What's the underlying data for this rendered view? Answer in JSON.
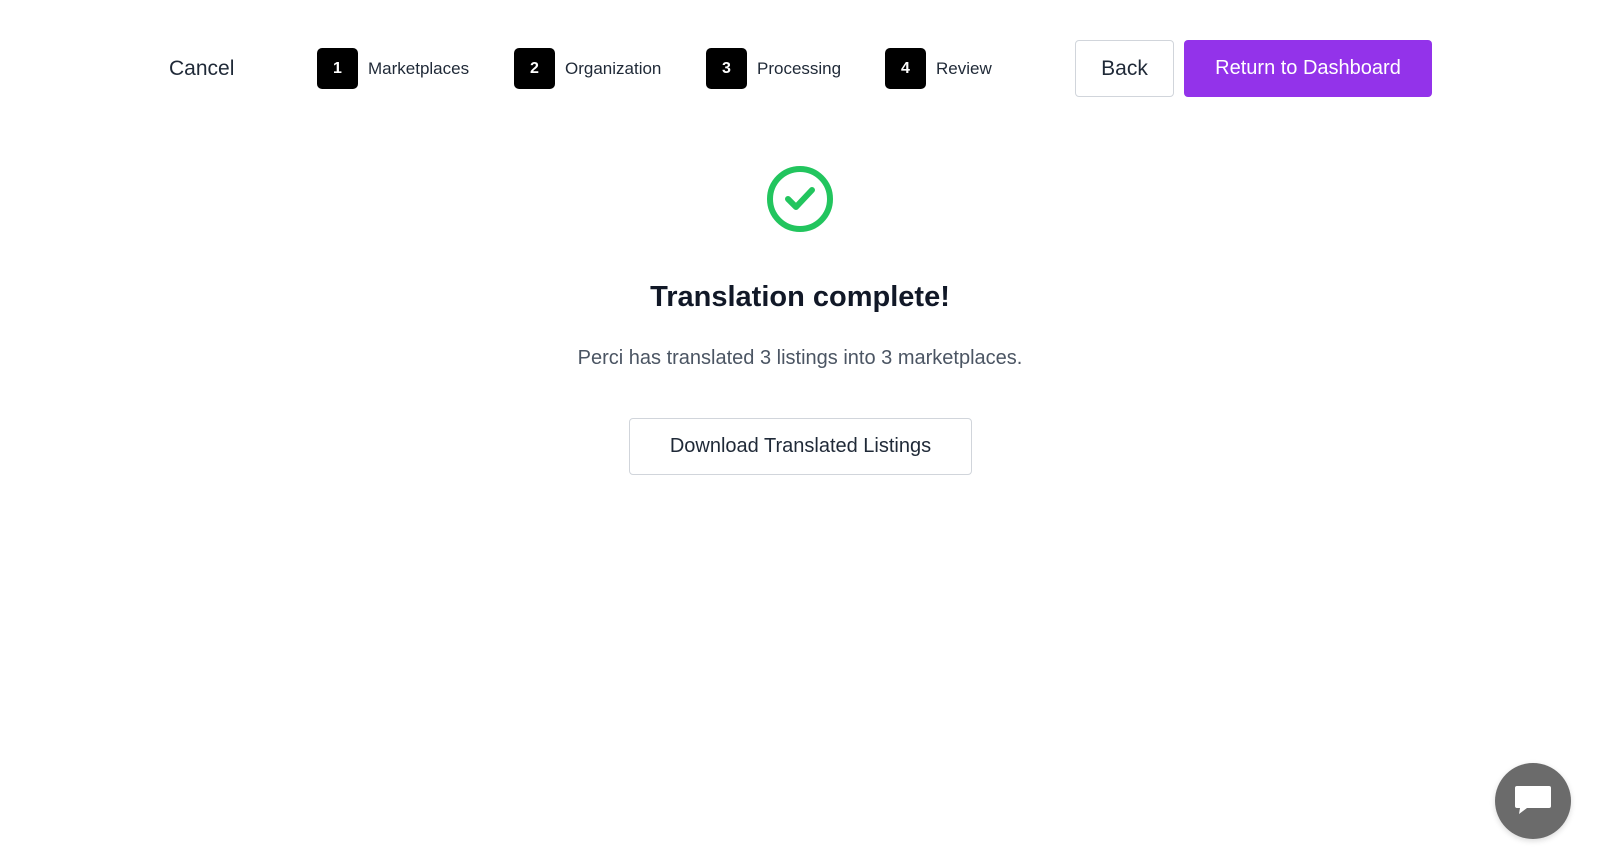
{
  "header": {
    "cancel_label": "Cancel",
    "steps": [
      {
        "number": "1",
        "label": "Marketplaces"
      },
      {
        "number": "2",
        "label": "Organization"
      },
      {
        "number": "3",
        "label": "Processing"
      },
      {
        "number": "4",
        "label": "Review"
      }
    ],
    "back_label": "Back",
    "dashboard_label": "Return to Dashboard"
  },
  "main": {
    "status_icon": "check-circle-icon",
    "title": "Translation complete!",
    "message": "Perci has translated 3 listings into 3 marketplaces.",
    "download_label": "Download Translated Listings"
  },
  "chat": {
    "icon": "chat-icon"
  },
  "colors": {
    "primary": "#9333ea",
    "success": "#22c55e",
    "step_badge": "#000000",
    "chat_bubble": "#6b6b6b"
  }
}
